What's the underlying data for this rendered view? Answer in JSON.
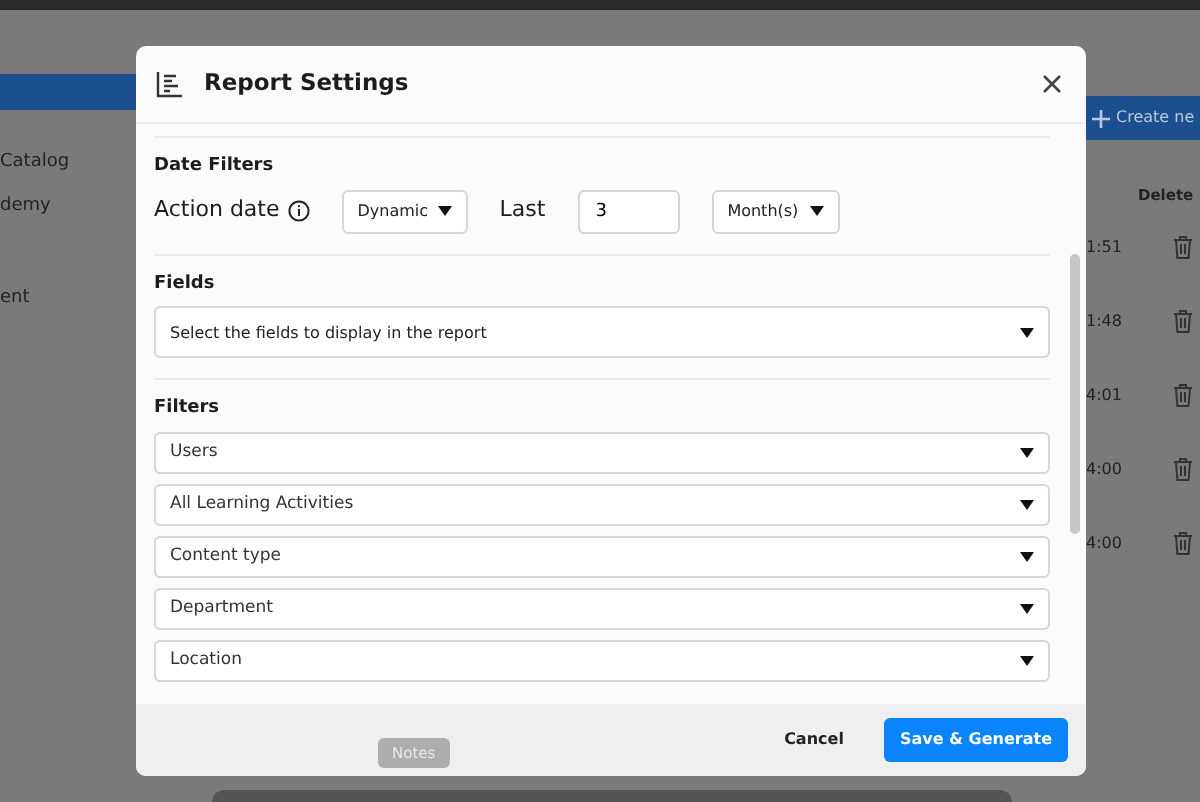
{
  "background": {
    "sidebar_items": [
      "Catalog",
      "demy",
      "ent"
    ],
    "create_button": "Create ne",
    "column_header": "Delete",
    "times": [
      "1:51",
      "1:48",
      "4:01",
      "4:00",
      "4:00"
    ]
  },
  "dialog": {
    "title": "Report Settings",
    "date_filters": {
      "title": "Date Filters",
      "label": "Action date",
      "mode": "Dynamic",
      "last_label": "Last",
      "value": "3",
      "unit": "Month(s)"
    },
    "fields": {
      "title": "Fields",
      "placeholder": "Select the fields to display in the report"
    },
    "filters": {
      "title": "Filters",
      "items": [
        "Users",
        "All Learning Activities",
        "Content type",
        "Department",
        "Location"
      ]
    },
    "buttons": [
      {
        "label": "Cancel",
        "kind": "secondary"
      },
      {
        "label": "Save & Generate",
        "kind": "primary"
      }
    ]
  },
  "dock": {
    "tooltip": "Notes"
  }
}
